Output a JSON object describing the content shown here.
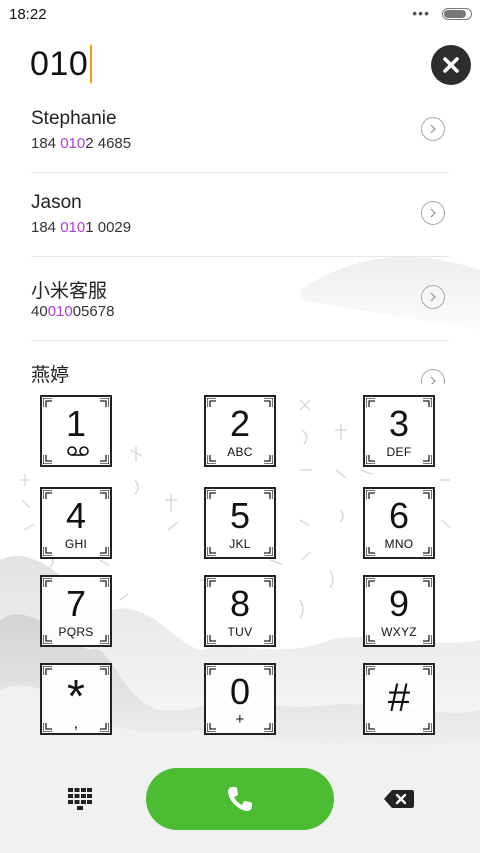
{
  "status_bar": {
    "time": "18:22",
    "dots": "•••",
    "battery_level": 0.9
  },
  "dial": {
    "entered_number": "010"
  },
  "results": [
    {
      "name": "Stephanie",
      "number_pre": "184 ",
      "number_match": "010",
      "number_post": "2 4685"
    },
    {
      "name": "Jason",
      "number_pre": "184 ",
      "number_match": "010",
      "number_post": "1 0029"
    },
    {
      "name": "小米客服",
      "number_pre": "40",
      "number_match": "010",
      "number_post": "05678"
    },
    {
      "name": "燕婷",
      "number_pre": "",
      "number_match": "",
      "number_post": ""
    }
  ],
  "keypad": [
    {
      "digit": "1",
      "sub": "voicemail"
    },
    {
      "digit": "2",
      "sub": "ABC"
    },
    {
      "digit": "3",
      "sub": "DEF"
    },
    {
      "digit": "4",
      "sub": "GHI"
    },
    {
      "digit": "5",
      "sub": "JKL"
    },
    {
      "digit": "6",
      "sub": "MNO"
    },
    {
      "digit": "7",
      "sub": "PQRS"
    },
    {
      "digit": "8",
      "sub": "TUV"
    },
    {
      "digit": "9",
      "sub": "WXYZ"
    },
    {
      "digit": "*",
      "sub": ","
    },
    {
      "digit": "0",
      "sub": "+"
    },
    {
      "digit": "#",
      "sub": ""
    }
  ],
  "colors": {
    "call_green": "#4cbd33",
    "match_purple": "#b03cd6",
    "caret_orange": "#f39c12"
  },
  "icons": {
    "clear": "close-icon",
    "chevron": "chevron-right-icon",
    "voicemail": "voicemail-icon",
    "call": "phone-icon",
    "dialpad_toggle": "dialpad-grid-icon",
    "backspace": "backspace-icon"
  }
}
